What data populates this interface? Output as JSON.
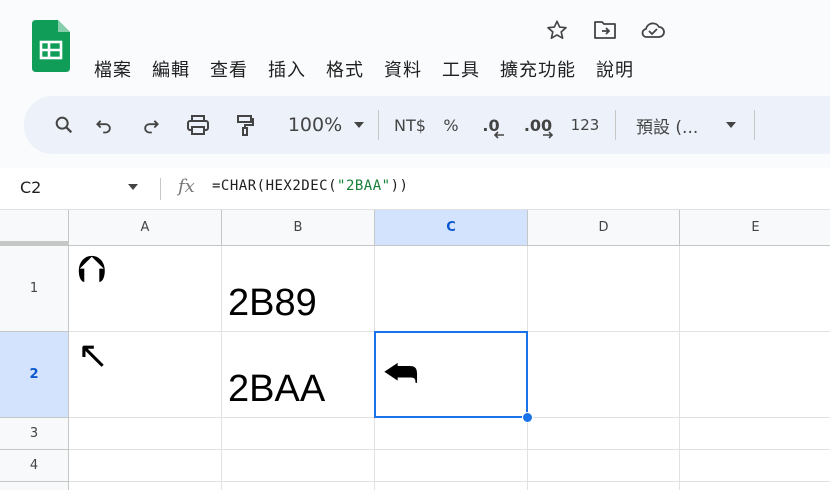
{
  "menu": [
    "檔案",
    "編輯",
    "查看",
    "插入",
    "格式",
    "資料",
    "工具",
    "擴充功能",
    "說明"
  ],
  "title_icons": [
    "star-icon",
    "move-to-folder-icon",
    "cloud-saved-icon"
  ],
  "toolbar": {
    "zoom": "100%",
    "currency": "NT$",
    "percent": "%",
    "decrease_decimal": ".0",
    "increase_decimal": ".00",
    "number_format": "123",
    "font": "預設 (...",
    "icons": [
      "search-icon",
      "undo-icon",
      "redo-icon",
      "print-icon",
      "paint-format-icon"
    ]
  },
  "formula_bar": {
    "name_box": "C2",
    "fx": "fx",
    "formula_prefix": "=CHAR(HEX2DEC(",
    "formula_string": "\"2BAA\"",
    "formula_suffix": "))"
  },
  "columns": [
    "A",
    "B",
    "C",
    "D",
    "E"
  ],
  "rows": [
    "1",
    "2",
    "3",
    "4"
  ],
  "cells": {
    "A1": "⮉",
    "B1": "2B89",
    "A2": "↖",
    "B2": "2BAA",
    "C2": "⮪"
  },
  "selection": {
    "cell": "C2",
    "column": "C",
    "row": "2",
    "color": "#1a73e8"
  },
  "colors": {
    "logo_green": "#0f9d58",
    "toolbar_bg": "#edf2fa",
    "header_selected": "#d3e3fd"
  }
}
